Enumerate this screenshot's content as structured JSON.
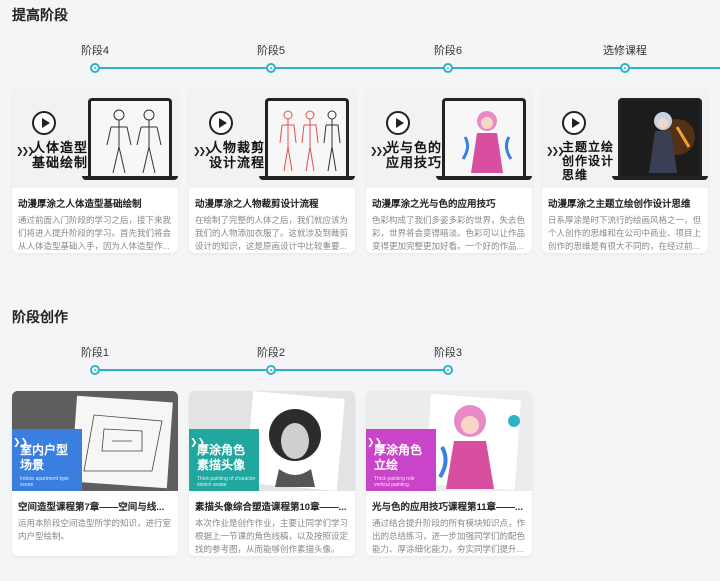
{
  "colors": {
    "accent": "#2bb3c8",
    "blue": "#3a7fe0",
    "teal": "#22a6a0",
    "magenta": "#c944c9"
  },
  "advanced": {
    "title": "提高阶段",
    "stages": [
      "阶段4",
      "阶段5",
      "阶段6",
      "选修课程"
    ],
    "cards": [
      {
        "thumb_text": "人体造型\n基础绘制",
        "title": "动漫厚涂之人体造型基础绘制",
        "desc": "通过前面入门阶段的学习之后，接下来我们将进入提升阶段的学习。首先我们将会从人体造型基础入手，因为人体造型作..."
      },
      {
        "thumb_text": "人物裁剪\n设计流程",
        "title": "动漫厚涂之人物裁剪设计流程",
        "desc": "在绘制了完整的人体之后，我们就应该为我们的人物添加衣服了。这就涉及到裁剪设计的知识，这是原画设计中比较重要..."
      },
      {
        "thumb_text": "光与色的\n应用技巧",
        "title": "动漫厚涂之光与色的应用技巧",
        "desc": "色彩构成了我们多姿多彩的世界，失去色彩，世界将会变得暗淡。色彩可以让作品变得更加完整更加好看。一个好的作品..."
      },
      {
        "thumb_text": "主题立绘\n创作设计\n思维",
        "title": "动漫厚涂之主题立绘创作设计思维",
        "desc": "日系厚涂是时下流行的绘画风格之一，但个人创作的思维和在公司中商业、项目上创作的思维是有很大不同的，在经过前..."
      }
    ]
  },
  "creation": {
    "title": "阶段创作",
    "stages": [
      "阶段1",
      "阶段2",
      "阶段3"
    ],
    "cards": [
      {
        "thumb_text": "室内户型\n场景",
        "thumb_sub": "Indoor apartment type\nscene",
        "title": "空间造型课程第7章——空间与线...",
        "desc": "运用本阶段空间造型所学的知识，进行室内户型绘制。"
      },
      {
        "thumb_text": "厚涂角色\n素描头像",
        "thumb_sub": "Thick painting of character\nsketch avatar",
        "title": "素描头像综合塑造课程第10章——...",
        "desc": "本次作业是创作作业，主要让同学们学习根据上一节课的角色线稿，以及按照设定找的参考图，从而能够创作素描头像。"
      },
      {
        "thumb_text": "厚涂角色\n立绘",
        "thumb_sub": "Thick painting role\nvertical painting",
        "title": "光与色的应用技巧课程第11章——...",
        "desc": "通过结合提升阶段的所有模块知识点，作出的总结练习，进一步加强同学们的配色能力、厚涂细化能力，夯实同学们提升..."
      }
    ]
  }
}
